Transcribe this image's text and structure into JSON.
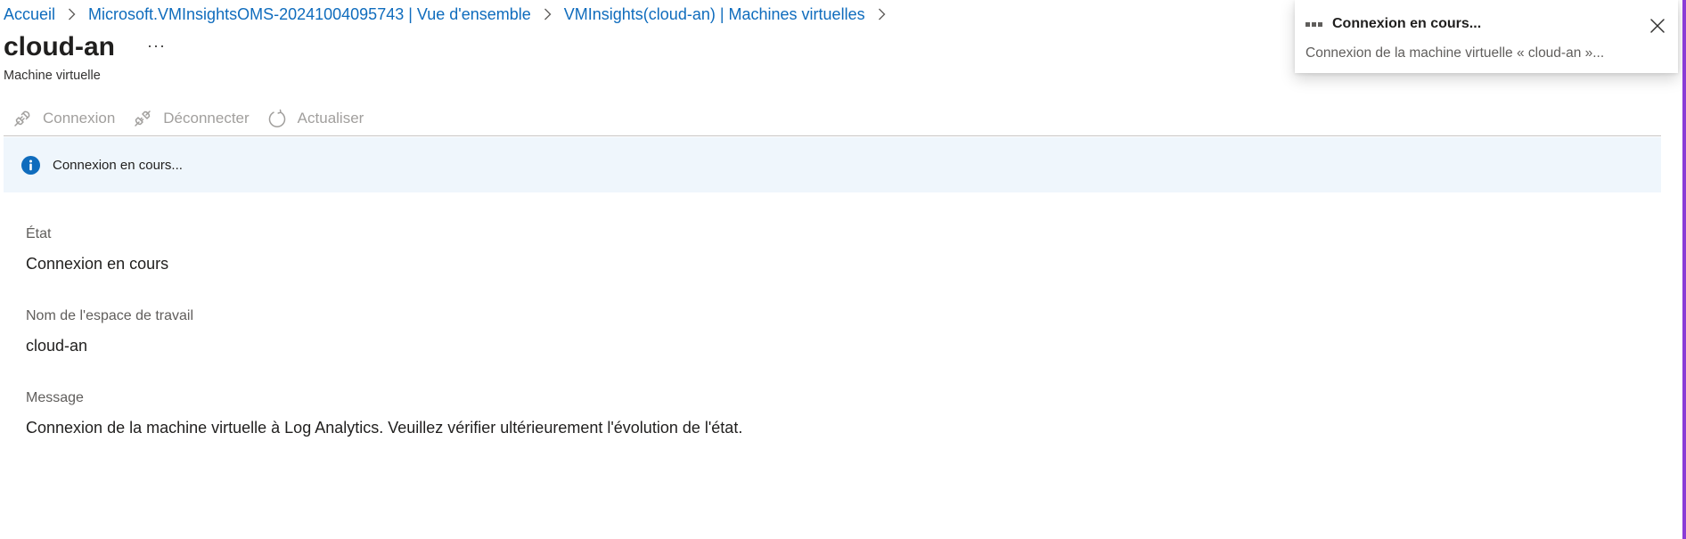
{
  "breadcrumb": {
    "items": [
      {
        "label": "Accueil"
      },
      {
        "label": "Microsoft.VMInsightsOMS-20241004095743 | Vue d'ensemble"
      },
      {
        "label": "VMInsights(cloud-an) | Machines virtuelles"
      }
    ]
  },
  "header": {
    "title": "cloud-an",
    "more_label": "···",
    "subtitle": "Machine virtuelle"
  },
  "toolbar": {
    "connect_label": "Connexion",
    "connect_icon": "plug-connect-icon",
    "disconnect_label": "Déconnecter",
    "disconnect_icon": "plug-disconnect-icon",
    "refresh_label": "Actualiser",
    "refresh_icon": "refresh-icon"
  },
  "banner": {
    "icon": "info-icon",
    "text": "Connexion en cours..."
  },
  "fields": {
    "state_label": "État",
    "state_value": "Connexion en cours",
    "workspace_label": "Nom de l'espace de travail",
    "workspace_value": "cloud-an",
    "message_label": "Message",
    "message_value": "Connexion de la machine virtuelle à Log Analytics. Veuillez vérifier ultérieurement l'évolution de l'état."
  },
  "notification": {
    "title": "Connexion en cours...",
    "body": "Connexion de la machine virtuelle « cloud-an »..."
  },
  "colors": {
    "link": "#0f6cbd",
    "banner_bg": "#eff6fc",
    "accent_border": "#8a3cd6",
    "disabled_text": "#a19f9d"
  }
}
